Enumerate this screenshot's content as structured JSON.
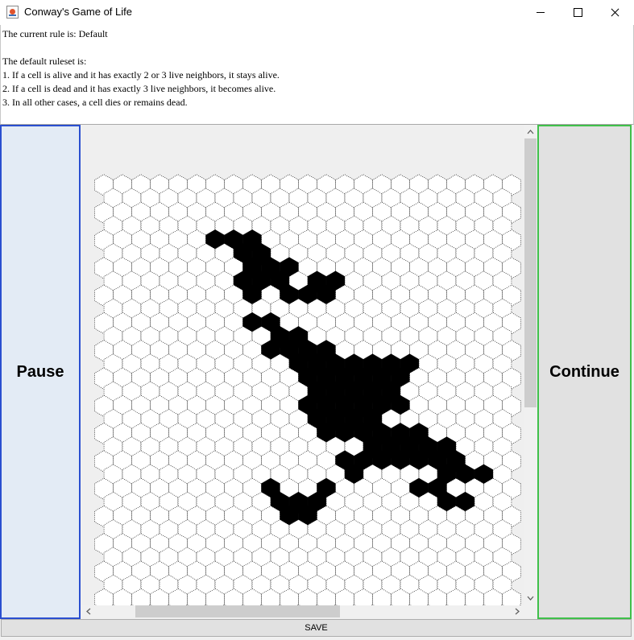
{
  "window": {
    "title": "Conway's Game of Life",
    "controls": [
      "minimize-icon",
      "maximize-icon",
      "close-icon"
    ]
  },
  "info": {
    "current_rule": "The current rule is: Default",
    "ruleset_heading": "The default ruleset is:",
    "rules": [
      "1. If a cell is alive and it has exactly 2 or 3 live neighbors, it stays alive.",
      "2. If a cell is dead and it has exactly 3 live neighbors, it becomes alive.",
      "3. In all other cases, a cell dies or remains dead."
    ]
  },
  "controls": {
    "pause_label": "Pause",
    "continue_label": "Continue",
    "save_label": "SAVE"
  },
  "colors": {
    "alive": "#000000",
    "dead": "#ffffff",
    "pause_border": "#2a4fd0",
    "continue_border": "#3fc04a"
  },
  "grid": {
    "cell_shape": "hexagon",
    "live_cells": [
      [
        7,
        5
      ],
      [
        7,
        4
      ],
      [
        6,
        4
      ],
      [
        8,
        4
      ],
      [
        8,
        5
      ],
      [
        8,
        8
      ],
      [
        7,
        7
      ],
      [
        8,
        7
      ],
      [
        9,
        7
      ],
      [
        8,
        6
      ],
      [
        9,
        6
      ],
      [
        10,
        6
      ],
      [
        8,
        10
      ],
      [
        9,
        10
      ],
      [
        10,
        11
      ],
      [
        9,
        11
      ],
      [
        10,
        12
      ],
      [
        9,
        12
      ],
      [
        11,
        12
      ],
      [
        12,
        12
      ],
      [
        11,
        13
      ],
      [
        12,
        13
      ],
      [
        13,
        13
      ],
      [
        14,
        13
      ],
      [
        11,
        14
      ],
      [
        12,
        14
      ],
      [
        13,
        14
      ],
      [
        14,
        14
      ],
      [
        15,
        14
      ],
      [
        11,
        15
      ],
      [
        12,
        15
      ],
      [
        13,
        15
      ],
      [
        14,
        15
      ],
      [
        15,
        15
      ],
      [
        16,
        14
      ],
      [
        15,
        13
      ],
      [
        16,
        13
      ],
      [
        11,
        16
      ],
      [
        12,
        16
      ],
      [
        13,
        16
      ],
      [
        14,
        16
      ],
      [
        15,
        16
      ],
      [
        16,
        16
      ],
      [
        11,
        17
      ],
      [
        12,
        17
      ],
      [
        13,
        17
      ],
      [
        14,
        17
      ],
      [
        12,
        18
      ],
      [
        13,
        18
      ],
      [
        14,
        18
      ],
      [
        15,
        18
      ],
      [
        16,
        18
      ],
      [
        17,
        18
      ],
      [
        15,
        19
      ],
      [
        16,
        19
      ],
      [
        17,
        19
      ],
      [
        18,
        19
      ],
      [
        14,
        19
      ],
      [
        13,
        20
      ],
      [
        14,
        20
      ],
      [
        15,
        20
      ],
      [
        16,
        20
      ],
      [
        17,
        20
      ],
      [
        18,
        20
      ],
      [
        19,
        20
      ],
      [
        18,
        21
      ],
      [
        19,
        21
      ],
      [
        20,
        21
      ],
      [
        13,
        21
      ],
      [
        12,
        22
      ],
      [
        10,
        13
      ],
      [
        9,
        22
      ],
      [
        9,
        23
      ],
      [
        10,
        23
      ],
      [
        11,
        23
      ],
      [
        10,
        24
      ],
      [
        11,
        24
      ],
      [
        17,
        22
      ],
      [
        18,
        22
      ],
      [
        18,
        23
      ],
      [
        19,
        23
      ],
      [
        11,
        7
      ],
      [
        10,
        8
      ],
      [
        11,
        8
      ],
      [
        12,
        8
      ],
      [
        12,
        7
      ]
    ]
  }
}
